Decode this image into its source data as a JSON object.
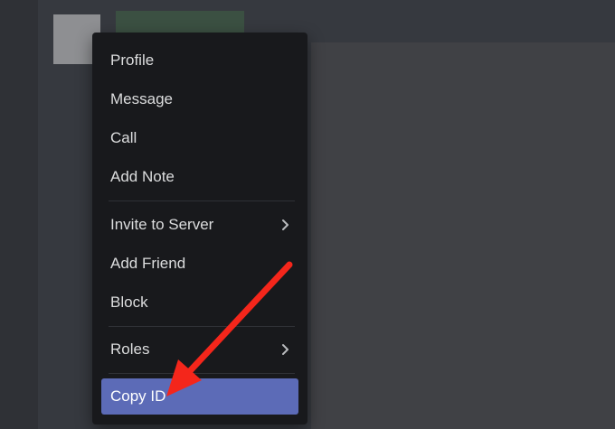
{
  "context_menu": {
    "items": [
      {
        "label": "Profile"
      },
      {
        "label": "Message"
      },
      {
        "label": "Call"
      },
      {
        "label": "Add Note"
      },
      {
        "label": "Invite to Server",
        "icon": "chevron-right-icon"
      },
      {
        "label": "Add Friend"
      },
      {
        "label": "Block"
      },
      {
        "label": "Roles",
        "icon": "chevron-right-icon"
      },
      {
        "label": "Copy ID",
        "state": "highlighted"
      }
    ]
  },
  "colors": {
    "background": "#36393f",
    "menu_background": "#18191c",
    "highlight": "#5c6bb7",
    "annotation_arrow": "#f4261b"
  }
}
